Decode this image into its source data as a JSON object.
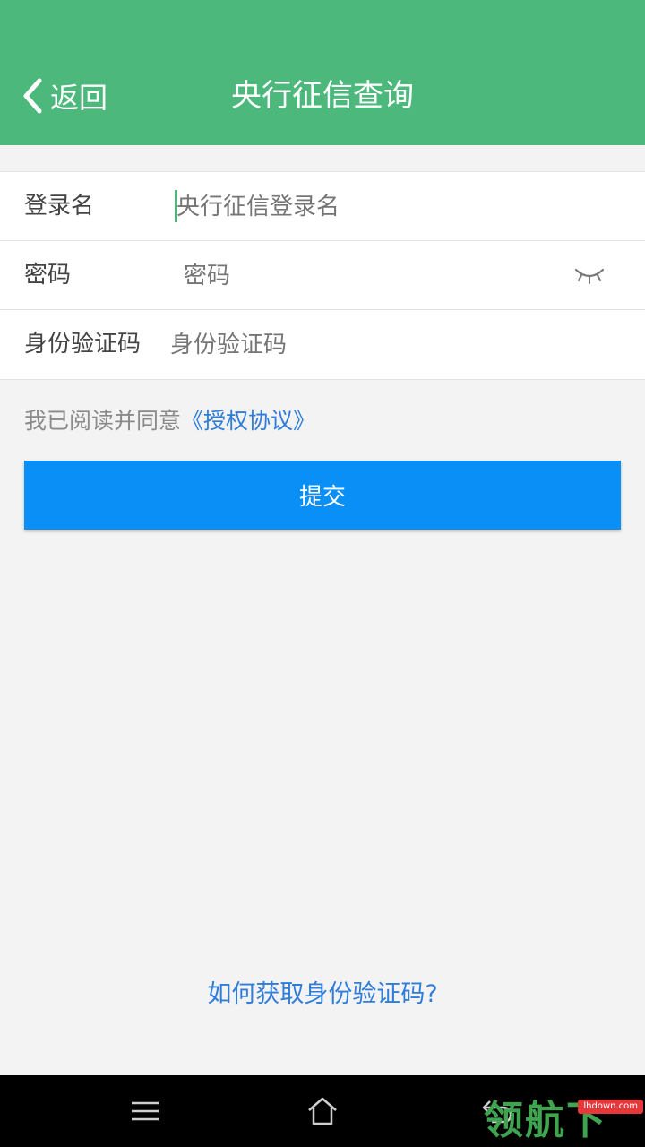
{
  "header": {
    "back_label": "返回",
    "title": "央行征信查询",
    "background_color": "#4cb87c"
  },
  "form": {
    "fields": [
      {
        "label": "登录名",
        "placeholder": "央行征信登录名"
      },
      {
        "label": "密码",
        "placeholder": "密码",
        "toggle_icon": "eye-closed-icon"
      },
      {
        "label": "身份验证码",
        "placeholder": "身份验证码"
      }
    ]
  },
  "agreement": {
    "text": "我已阅读并同意",
    "link": "《授权协议》"
  },
  "submit": {
    "label": "提交",
    "color": "#0a8ff7"
  },
  "help_link": "如何获取身份验证码?",
  "system_nav": {
    "icons": [
      "menu-icon",
      "home-icon",
      "back-icon"
    ]
  },
  "watermark": {
    "text": "领航下载",
    "tag": "lhdown.com"
  }
}
